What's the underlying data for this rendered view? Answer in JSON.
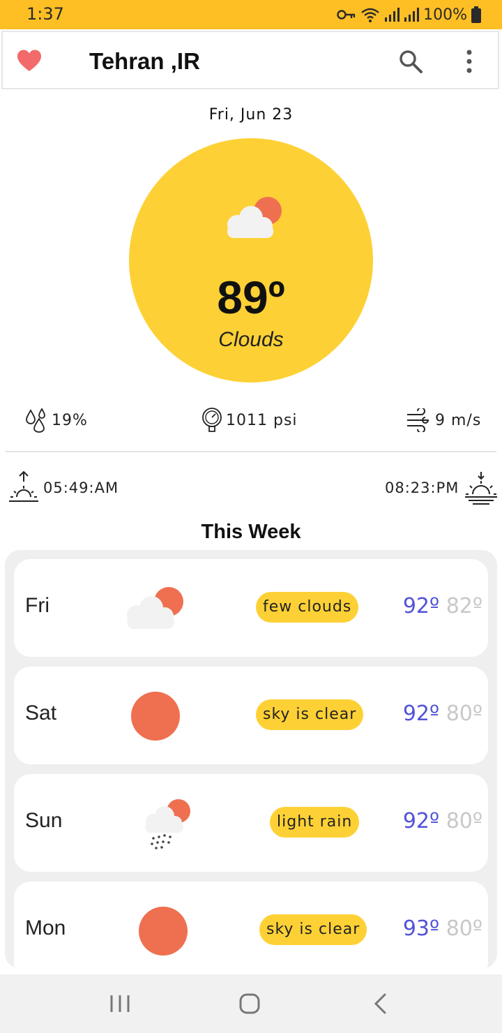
{
  "status_bar": {
    "time": "1:37",
    "battery": "100%"
  },
  "app_bar": {
    "title": "Tehran ,IR"
  },
  "current": {
    "date": "Fri, Jun 23",
    "temperature": "89º",
    "condition": "Clouds",
    "humidity": "19%",
    "pressure": "1011 psi",
    "wind": "9 m/s",
    "sunrise": "05:49:AM",
    "sunset": "08:23:PM"
  },
  "week": {
    "title": "This Week",
    "days": [
      {
        "day": "Fri",
        "icon": "few-clouds-icon",
        "desc": "few clouds",
        "high": "92º",
        "low": "82º"
      },
      {
        "day": "Sat",
        "icon": "clear-sky-icon",
        "desc": "sky is clear",
        "high": "92º",
        "low": "80º"
      },
      {
        "day": "Sun",
        "icon": "light-rain-icon",
        "desc": "light rain",
        "high": "92º",
        "low": "80º"
      },
      {
        "day": "Mon",
        "icon": "clear-sky-icon",
        "desc": "sky is clear",
        "high": "93º",
        "low": "80º"
      }
    ]
  },
  "colors": {
    "accent": "#FDD135",
    "status_bar": "#FDBF24",
    "sun": "#EE7050",
    "high": "#5252D8",
    "low": "#C8C8C8",
    "heart": "#F26A6A"
  }
}
